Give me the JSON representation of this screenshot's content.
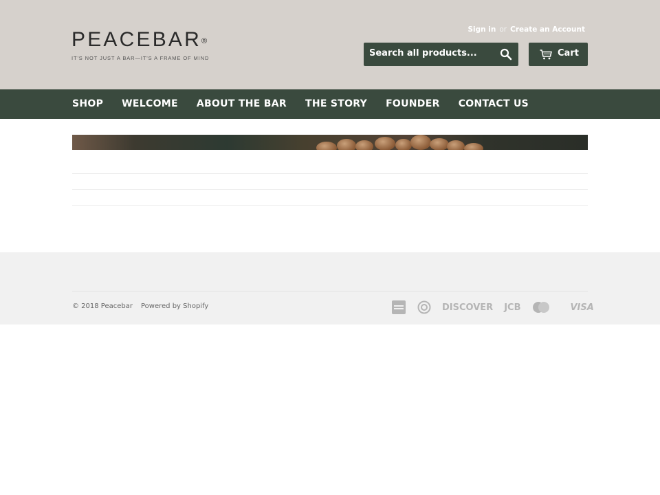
{
  "header": {
    "brand": "PEACEBAR",
    "brand_mark": "®",
    "tagline": "IT'S NOT JUST A BAR—IT'S A FRAME OF MIND",
    "sign_in": "Sign in",
    "or": "or",
    "create_account": "Create an Account",
    "search_placeholder": "Search all products...",
    "cart_label": "Cart"
  },
  "nav": {
    "items": [
      {
        "label": "SHOP"
      },
      {
        "label": "WELCOME"
      },
      {
        "label": "ABOUT THE BAR"
      },
      {
        "label": "THE STORY"
      },
      {
        "label": "FOUNDER"
      },
      {
        "label": "CONTACT US"
      }
    ]
  },
  "footer": {
    "copyright": "© 2018 Peacebar",
    "powered_by": "Powered by Shopify",
    "payment_icons": [
      "american-express-icon",
      "diners-club-icon",
      "discover-icon",
      "jcb-icon",
      "master-icon",
      "visa-icon"
    ],
    "payment_labels": {
      "discover": "DISCOVER",
      "jcb": "JCB",
      "visa": "VISA"
    }
  },
  "colors": {
    "header_bg": "#d6d1cc",
    "nav_bg": "#3a4a3e",
    "footer_bg": "#f1f1f1"
  }
}
